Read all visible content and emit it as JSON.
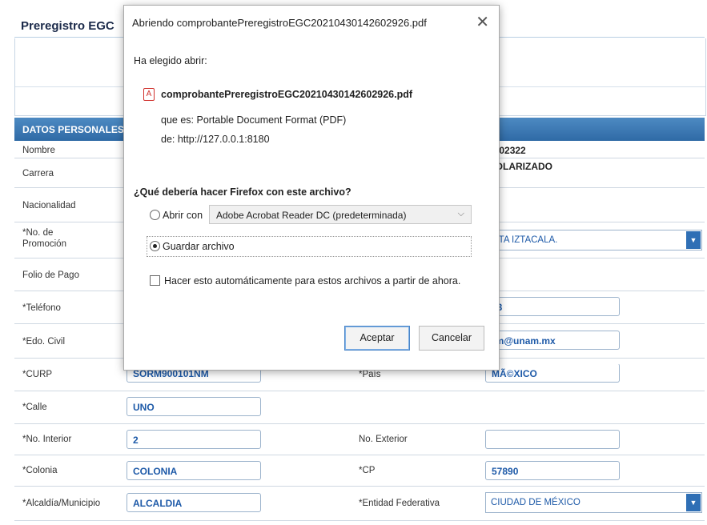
{
  "page": {
    "title": "Preregistro EGC",
    "section": "DATOS PERSONALES",
    "rows": {
      "nombre": {
        "label": "Nombre",
        "value": "3102322"
      },
      "carrera": {
        "label": "Carrera",
        "value": "COLARIZADO"
      },
      "nacionalidad": {
        "label": "Nacionalidad"
      },
      "promocion": {
        "label": "*No. de Promoción",
        "value": "ACETA IZTACALA."
      },
      "folio": {
        "label": "Folio de Pago"
      },
      "telefono": {
        "label": "*Teléfono",
        "value": "23"
      },
      "edo_civil": {
        "label": "*Edo. Civil",
        "value": "rm@unam.mx"
      },
      "curp": {
        "label": "*CURP",
        "value": "SORM900101NM"
      },
      "pais": {
        "label": "*País",
        "value": "MÃ©XICO"
      },
      "calle": {
        "label": "*Calle",
        "value": "UNO"
      },
      "no_interior": {
        "label": "*No. Interior",
        "value": "2"
      },
      "no_exterior": {
        "label": "No. Exterior",
        "value": ""
      },
      "colonia": {
        "label": "*Colonia",
        "value": "COLONIA"
      },
      "cp": {
        "label": "*CP",
        "value": "57890"
      },
      "alcaldia": {
        "label": "*Alcaldía/Municipio",
        "value": "ALCALDIA"
      },
      "entidad": {
        "label": "*Entidad Federativa",
        "value": "CIUDAD DE MÉXICO"
      }
    }
  },
  "dialog": {
    "title": "Abriendo comprobantePreregistroEGC20210430142602926.pdf",
    "chosen_label": "Ha elegido abrir:",
    "file_name": "comprobantePreregistroEGC20210430142602926.pdf",
    "file_type": "que es: Portable Document Format (PDF)",
    "file_source": "de: http://127.0.0.1:8180",
    "question": "¿Qué debería hacer Firefox con este archivo?",
    "open_with_label": "Abrir con",
    "app_selected": "Adobe Acrobat Reader DC (predeterminada)",
    "save_label": "Guardar archivo",
    "auto_label": "Hacer esto automáticamente para estos archivos a partir de ahora.",
    "accept": "Aceptar",
    "cancel": "Cancelar",
    "close_glyph": "✕"
  }
}
